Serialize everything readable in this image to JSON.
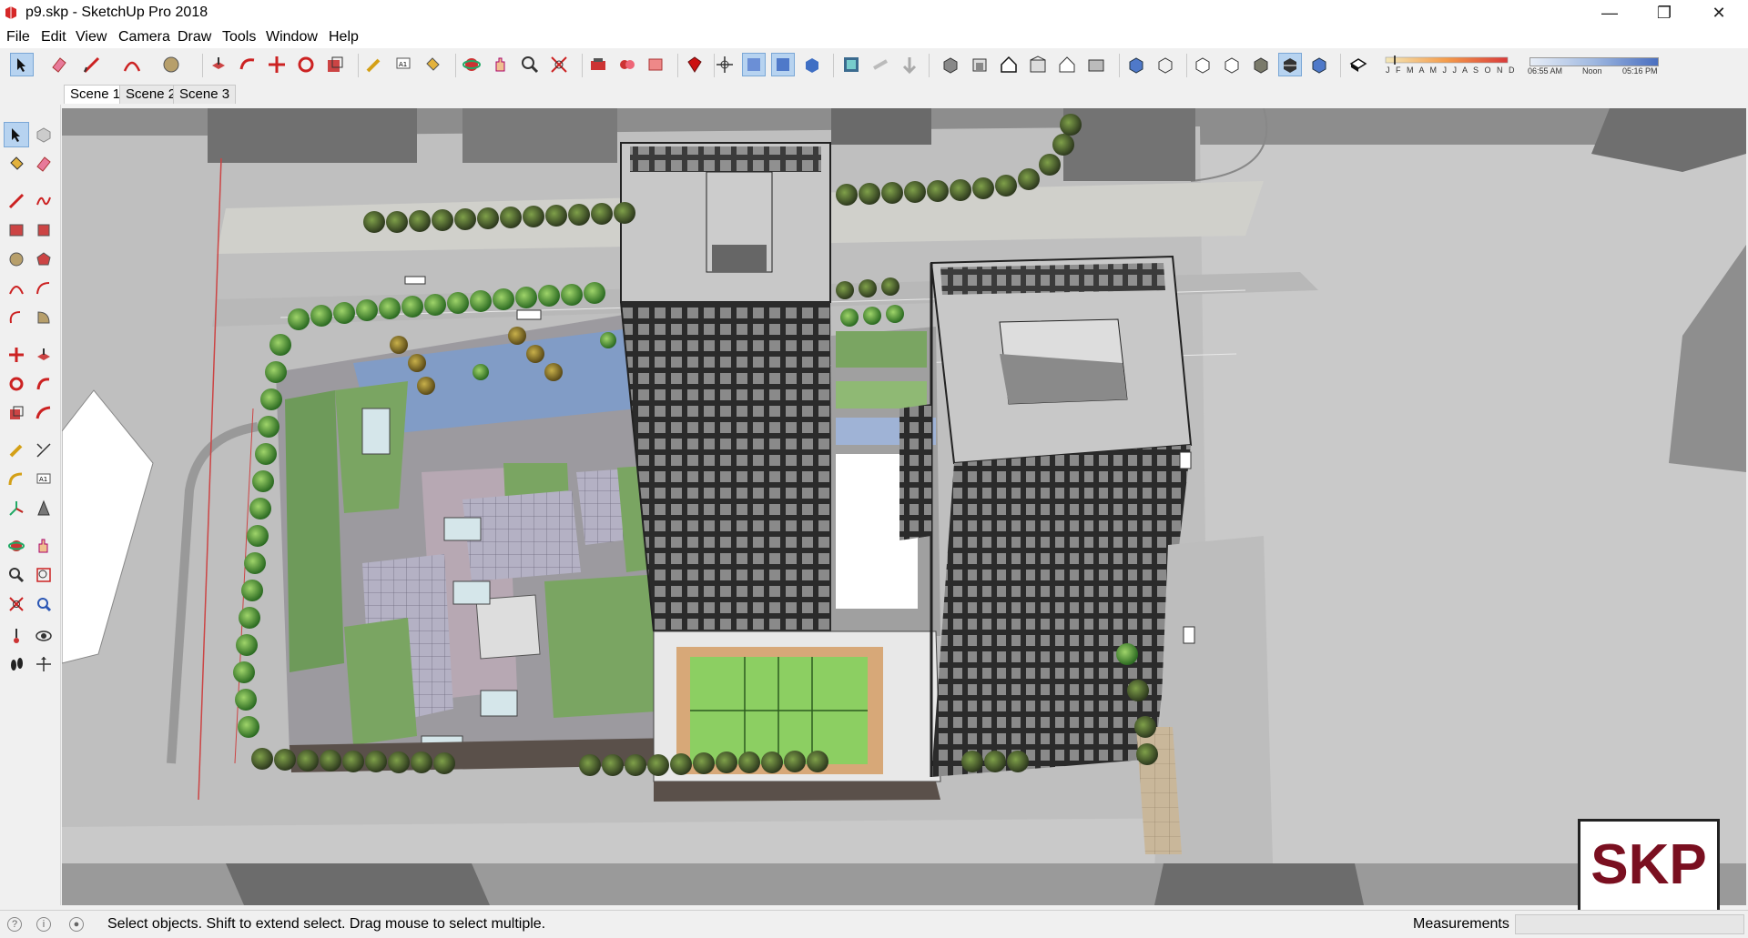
{
  "window": {
    "title": "p9.skp - SketchUp Pro 2018",
    "app_icon": "sketchup-app-icon",
    "controls": [
      "minimize-icon",
      "restore-icon",
      "close-icon"
    ]
  },
  "menu": {
    "items": [
      "File",
      "Edit",
      "View",
      "Camera",
      "Draw",
      "Tools",
      "Window",
      "Help"
    ]
  },
  "toolbar": {
    "icons": [
      "select-icon",
      "eraser-icon",
      "pencil-line-icon",
      "arc-icon",
      "circle-icon",
      "push-pull-icon",
      "follow-me-icon",
      "move-icon",
      "rotate-icon",
      "scale-icon",
      "tape-measure-icon",
      "text-icon",
      "paint-bucket-icon",
      "orbit-icon",
      "pan-icon",
      "zoom-icon",
      "zoom-extents-icon",
      "warehouse-icon",
      "extension-icon",
      "layout-icon",
      "ruby-icon",
      "position-camera-icon",
      "walk-icon",
      "look-around-icon",
      "section-plane-icon",
      "display-section-icon",
      "section-cut-icon",
      "iso-view-icon",
      "top-view-icon",
      "front-view-icon",
      "right-view-icon",
      "back-view-icon",
      "left-view-icon",
      "xray-icon",
      "back-edges-icon",
      "wireframe-icon",
      "hidden-line-icon",
      "shaded-icon",
      "shaded-textures-icon",
      "monochrome-icon",
      "shadows-icon"
    ],
    "shadow_months": "J F M A M J J A S O N D",
    "time_start": "06:55 AM",
    "time_noon": "Noon",
    "time_end": "05:16 PM"
  },
  "scenes": {
    "tabs": [
      "Scene 1",
      "Scene 2",
      "Scene 3"
    ],
    "active": "Scene 1"
  },
  "left_toolbar": {
    "icons": [
      "select-icon",
      "component-icon",
      "paint-bucket-icon",
      "eraser-icon",
      "line-icon",
      "freehand-icon",
      "rectangle-icon",
      "rotated-rectangle-icon",
      "circle-icon",
      "polygon-icon",
      "arc-icon",
      "two-point-arc-icon",
      "three-point-arc-icon",
      "pie-icon",
      "move-icon",
      "push-pull-icon",
      "rotate-icon",
      "follow-me-icon",
      "scale-icon",
      "offset-icon",
      "tape-measure-icon",
      "dimension-icon",
      "protractor-icon",
      "text-icon",
      "axes-icon",
      "3d-text-icon",
      "orbit-icon",
      "pan-icon",
      "zoom-icon",
      "zoom-window-icon",
      "zoom-extents-icon",
      "previous-view-icon",
      "position-camera-icon",
      "look-around-icon",
      "walk-icon",
      "section-plane-icon"
    ]
  },
  "status": {
    "message": "Select objects. Shift to extend select. Drag mouse to select multiple.",
    "measurements_label": "Measurements",
    "measurements_value": ""
  },
  "logo": {
    "text": "SKP"
  }
}
